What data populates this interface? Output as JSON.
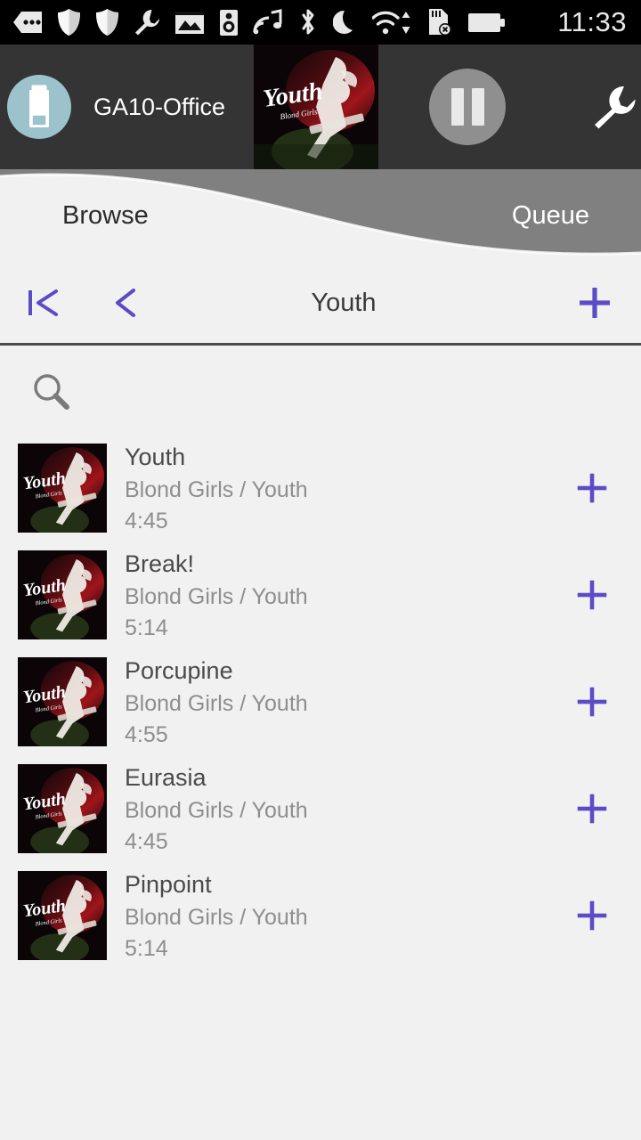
{
  "statusbar": {
    "time": "11:33",
    "icons": [
      {
        "name": "messages-icon",
        "glyph": "message-dots"
      },
      {
        "name": "shield-icon",
        "glyph": "shield"
      },
      {
        "name": "shield-secondary-icon",
        "glyph": "shield"
      },
      {
        "name": "wrench-icon",
        "glyph": "wrench"
      },
      {
        "name": "gallery-icon",
        "glyph": "image"
      },
      {
        "name": "speaker-icon",
        "glyph": "speaker"
      },
      {
        "name": "music-cast-icon",
        "glyph": "music-wifi"
      },
      {
        "name": "bluetooth-icon",
        "glyph": "bluetooth"
      },
      {
        "name": "do-not-disturb-icon",
        "glyph": "moon"
      },
      {
        "name": "wifi-icon",
        "glyph": "wifi-updown"
      },
      {
        "name": "sd-card-removed-icon",
        "glyph": "sdcard-x"
      },
      {
        "name": "battery-icon",
        "glyph": "battery"
      }
    ]
  },
  "header": {
    "device_name": "GA10-Office",
    "device_icon": "speaker-device-icon",
    "device_circle_color": "#9cc2cc",
    "background_color": "#343434",
    "now_playing_cover_title": "Youth",
    "now_playing_cover_subtitle": "Blond Girls",
    "transport": {
      "label": "Pause",
      "icon": "pause-icon",
      "button_color": "#8f8f8f"
    },
    "settings": {
      "label": "Settings",
      "icon": "wrench-icon"
    }
  },
  "tabs": {
    "active": "Browse",
    "items": [
      {
        "label": "Browse",
        "active": true
      },
      {
        "label": "Queue",
        "active": false
      }
    ],
    "active_bg": "#f1f1f1",
    "inactive_bg": "#808080"
  },
  "navbar": {
    "first_icon": "skip-to-first-icon",
    "back_icon": "chevron-left-icon",
    "title": "Youth",
    "add_icon": "plus-icon",
    "accent_color": "#5b4bc4"
  },
  "search": {
    "icon": "search-icon",
    "placeholder": ""
  },
  "tracks": [
    {
      "title": "Youth",
      "subtitle": "Blond Girls / Youth",
      "duration": "4:45",
      "art_title": "Youth",
      "art_subtitle": "Blond Girls",
      "add_icon": "plus-icon"
    },
    {
      "title": "Break!",
      "subtitle": "Blond Girls / Youth",
      "duration": "5:14",
      "art_title": "Youth",
      "art_subtitle": "Blond Girls",
      "add_icon": "plus-icon"
    },
    {
      "title": "Porcupine",
      "subtitle": "Blond Girls / Youth",
      "duration": "4:55",
      "art_title": "Youth",
      "art_subtitle": "Blond Girls",
      "add_icon": "plus-icon"
    },
    {
      "title": "Eurasia",
      "subtitle": "Blond Girls / Youth",
      "duration": "4:45",
      "art_title": "Youth",
      "art_subtitle": "Blond Girls",
      "add_icon": "plus-icon"
    },
    {
      "title": "Pinpoint",
      "subtitle": "Blond Girls / Youth",
      "duration": "5:14",
      "art_title": "Youth",
      "art_subtitle": "Blond Girls",
      "add_icon": "plus-icon"
    }
  ],
  "colors": {
    "accent": "#5b4bc4",
    "page_bg": "#f1f1f1",
    "header_bg": "#343434",
    "statusbar_bg": "#000000",
    "inactive_tab": "#808080",
    "title_text": "#4a4a4a",
    "subtitle_text": "#8e8e8e"
  }
}
